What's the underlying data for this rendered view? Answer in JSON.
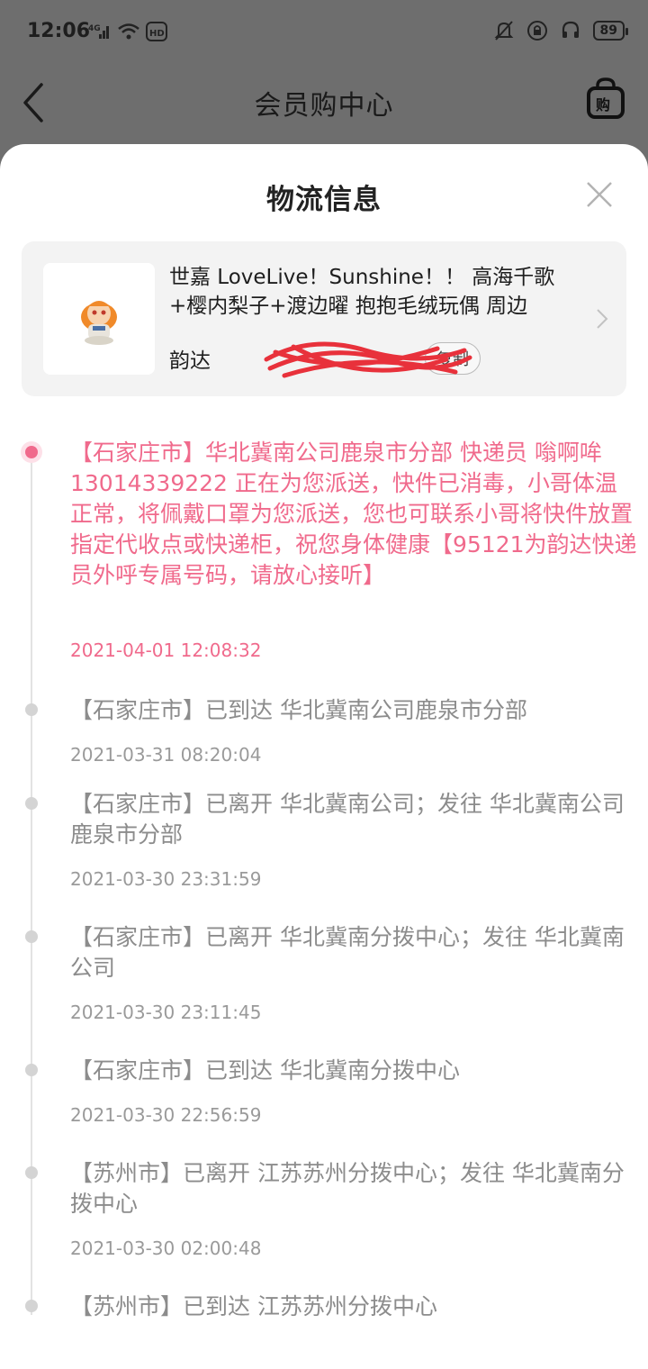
{
  "status_bar": {
    "time": "12:06",
    "network": "4G",
    "hd_label": "HD",
    "battery": "89"
  },
  "header": {
    "title": "会员购中心"
  },
  "sheet": {
    "title": "物流信息"
  },
  "product": {
    "name": "世嘉 LoveLive！Sunshine！！ 高海千歌+樱内梨子+渡边曜 抱抱毛绒玩偶 周边",
    "carrier": "韵达",
    "copy_label": "复制"
  },
  "timeline": [
    {
      "text": "【石家庄市】华北冀南公司鹿泉市分部 快递员 嗡啊哞13014339222 正在为您派送，快件已消毒，小哥体温正常，将佩戴口罩为您派送，您也可联系小哥将快件放置指定代收点或快递柜，祝您身体健康【95121为韵达快递员外呼专属号码，请放心接听】",
      "time": "2021-04-01 12:08:32",
      "active": true
    },
    {
      "text": "【石家庄市】已到达 华北冀南公司鹿泉市分部",
      "time": "2021-03-31 08:20:04",
      "active": false
    },
    {
      "text": "【石家庄市】已离开 华北冀南公司；发往 华北冀南公司鹿泉市分部",
      "time": "2021-03-30 23:31:59",
      "active": false
    },
    {
      "text": "【石家庄市】已离开 华北冀南分拨中心；发往 华北冀南公司",
      "time": "2021-03-30 23:11:45",
      "active": false
    },
    {
      "text": "【石家庄市】已到达 华北冀南分拨中心",
      "time": "2021-03-30 22:56:59",
      "active": false
    },
    {
      "text": "【苏州市】已离开 江苏苏州分拨中心；发往 华北冀南分拨中心",
      "time": "2021-03-30 02:00:48",
      "active": false
    },
    {
      "text": "【苏州市】已到达 江苏苏州分拨中心",
      "time": "",
      "active": false
    }
  ],
  "colors": {
    "accent": "#f06a8c",
    "overlay": "#6e6e6e",
    "muted_text": "#8c8c8c"
  }
}
